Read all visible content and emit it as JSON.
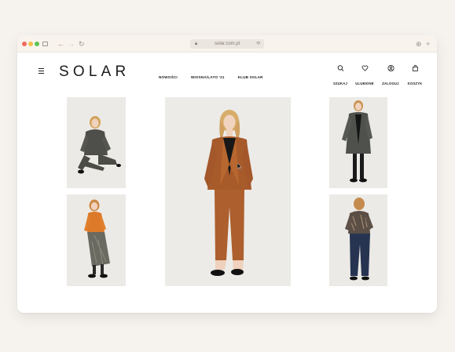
{
  "browser": {
    "url": "solar.com.pl",
    "icons": [
      "sidebar-icon",
      "back-icon",
      "forward-icon",
      "reload-icon",
      "download-icon",
      "new-tab-icon"
    ]
  },
  "site": {
    "logo": "SOLAR",
    "nav": [
      {
        "label": "NOWOŚCI"
      },
      {
        "label": "WIOSNA/LATO '21"
      },
      {
        "label": "KLUB SOLAR"
      }
    ],
    "utilities": [
      {
        "label": "SZUKAJ",
        "icon": "search-icon"
      },
      {
        "label": "ULUBIONE",
        "icon": "heart-icon"
      },
      {
        "label": "ZALOGUJ",
        "icon": "user-icon"
      },
      {
        "label": "KOSZYK",
        "icon": "bag-icon"
      }
    ]
  },
  "colors": {
    "accent_outfit": "#a85a2a",
    "photo_bg": "#ecebe8",
    "text": "#1a1a1a"
  }
}
